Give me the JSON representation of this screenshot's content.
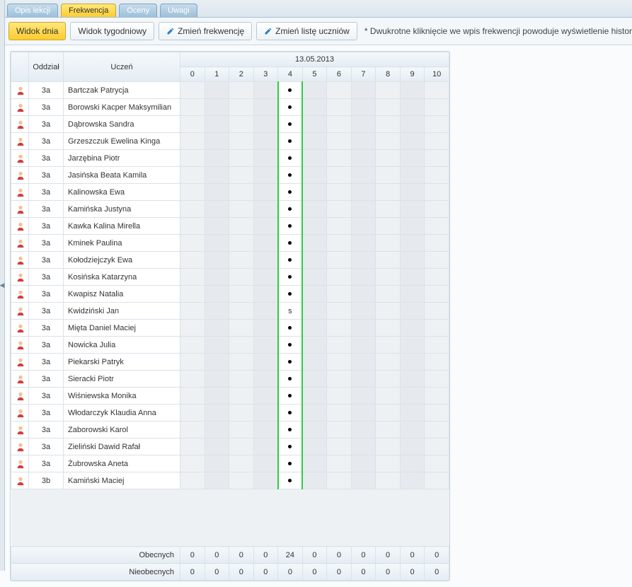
{
  "topTabs": [
    {
      "id": "opis",
      "label": "Opis lekcji",
      "active": false
    },
    {
      "id": "frek",
      "label": "Frekwencja",
      "active": true
    },
    {
      "id": "oceny",
      "label": "Oceny",
      "active": false
    },
    {
      "id": "uwagi",
      "label": "Uwagi",
      "active": false
    }
  ],
  "toolbar": {
    "dayView": "Widok dnia",
    "weekView": "Widok tygodniowy",
    "editAtt": "Zmień frekwencję",
    "editList": "Zmień listę uczniów",
    "hint": "* Dwukrotne kliknięcie we wpis frekwencji powoduje wyświetlenie historii wpisów"
  },
  "headers": {
    "group": "Oddział",
    "student": "Uczeń",
    "date": "13.05.2013"
  },
  "dayColumns": [
    "0",
    "1",
    "2",
    "3",
    "4",
    "5",
    "6",
    "7",
    "8",
    "9",
    "10"
  ],
  "highlightedColumn": 4,
  "rows": [
    {
      "group": "3a",
      "name": "Bartczak Patrycja",
      "col4": "dot"
    },
    {
      "group": "3a",
      "name": "Borowski Kacper Maksymilian",
      "col4": "dot"
    },
    {
      "group": "3a",
      "name": "Dąbrowska Sandra",
      "col4": "dot"
    },
    {
      "group": "3a",
      "name": "Grzeszczuk Ewelina Kinga",
      "col4": "dot"
    },
    {
      "group": "3a",
      "name": "Jarzębina Piotr",
      "col4": "dot"
    },
    {
      "group": "3a",
      "name": "Jasińska Beata Kamila",
      "col4": "dot"
    },
    {
      "group": "3a",
      "name": "Kalinowska Ewa",
      "col4": "dot"
    },
    {
      "group": "3a",
      "name": "Kamińska Justyna",
      "col4": "dot"
    },
    {
      "group": "3a",
      "name": "Kawka Kalina Mirella",
      "col4": "dot"
    },
    {
      "group": "3a",
      "name": "Kminek Paulina",
      "col4": "dot"
    },
    {
      "group": "3a",
      "name": "Kołodziejczyk Ewa",
      "col4": "dot"
    },
    {
      "group": "3a",
      "name": "Kosińska Katarzyna",
      "col4": "dot"
    },
    {
      "group": "3a",
      "name": "Kwapisz Natalia",
      "col4": "dot"
    },
    {
      "group": "3a",
      "name": "Kwidziński Jan",
      "col4": "s"
    },
    {
      "group": "3a",
      "name": "Mięta Daniel Maciej",
      "col4": "dot"
    },
    {
      "group": "3a",
      "name": "Nowicka Julia",
      "col4": "dot"
    },
    {
      "group": "3a",
      "name": "Piekarski Patryk",
      "col4": "dot"
    },
    {
      "group": "3a",
      "name": "Sieracki Piotr",
      "col4": "dot"
    },
    {
      "group": "3a",
      "name": "Wiśniewska Monika",
      "col4": "dot"
    },
    {
      "group": "3a",
      "name": "Włodarczyk Klaudia Anna",
      "col4": "dot"
    },
    {
      "group": "3a",
      "name": "Zaborowski Karol",
      "col4": "dot"
    },
    {
      "group": "3a",
      "name": "Zieliński Dawid Rafał",
      "col4": "dot"
    },
    {
      "group": "3a",
      "name": "Żubrowska Aneta",
      "col4": "dot"
    },
    {
      "group": "3b",
      "name": "Kamiński Maciej",
      "col4": "dot"
    }
  ],
  "summary": {
    "presentLabel": "Obecnych",
    "absentLabel": "Nieobecnych",
    "present": [
      "0",
      "0",
      "0",
      "0",
      "24",
      "0",
      "0",
      "0",
      "0",
      "0",
      "0"
    ],
    "absent": [
      "0",
      "0",
      "0",
      "0",
      "0",
      "0",
      "0",
      "0",
      "0",
      "0",
      "0"
    ]
  }
}
